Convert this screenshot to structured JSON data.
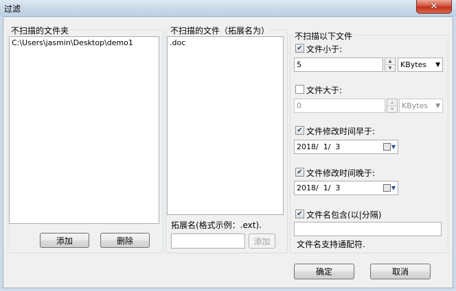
{
  "window": {
    "title": "过滤",
    "close_glyph": "✕"
  },
  "folders_panel": {
    "title": "不扫描的文件夹",
    "items": [
      "C:\\Users\\jasmin\\Desktop\\demo1"
    ],
    "add_label": "添加",
    "delete_label": "删除"
  },
  "files_panel": {
    "title": "不扫描的文件（拓展名为）",
    "items": [
      ".doc"
    ],
    "ext_hint": "拓展名(格式示例：.ext).",
    "ext_input_value": "",
    "add_label": "添加"
  },
  "conditions": {
    "title": "不扫描以下文件",
    "size_less": {
      "label": "文件小于:",
      "checked": true,
      "value": "5",
      "unit": "KBytes"
    },
    "size_greater": {
      "label": "文件大于:",
      "checked": false,
      "value": "0",
      "unit": "KBytes"
    },
    "modified_before": {
      "label": "文件修改时间早于:",
      "checked": true,
      "date": "2018/  1/  3"
    },
    "modified_after": {
      "label": "文件修改时间晚于:",
      "checked": true,
      "date": "2018/  1/  3"
    },
    "name_contains": {
      "label": "文件名包含(以|分隔)",
      "checked": true,
      "value": "",
      "hint": "文件名支持通配符."
    }
  },
  "footer": {
    "ok_label": "确定",
    "cancel_label": "取消"
  },
  "icons": {
    "close": "close-icon",
    "spin_up": "triangle-up-icon",
    "spin_down": "triangle-down-icon",
    "dropdown": "chevron-down-icon",
    "calendar": "calendar-icon"
  }
}
